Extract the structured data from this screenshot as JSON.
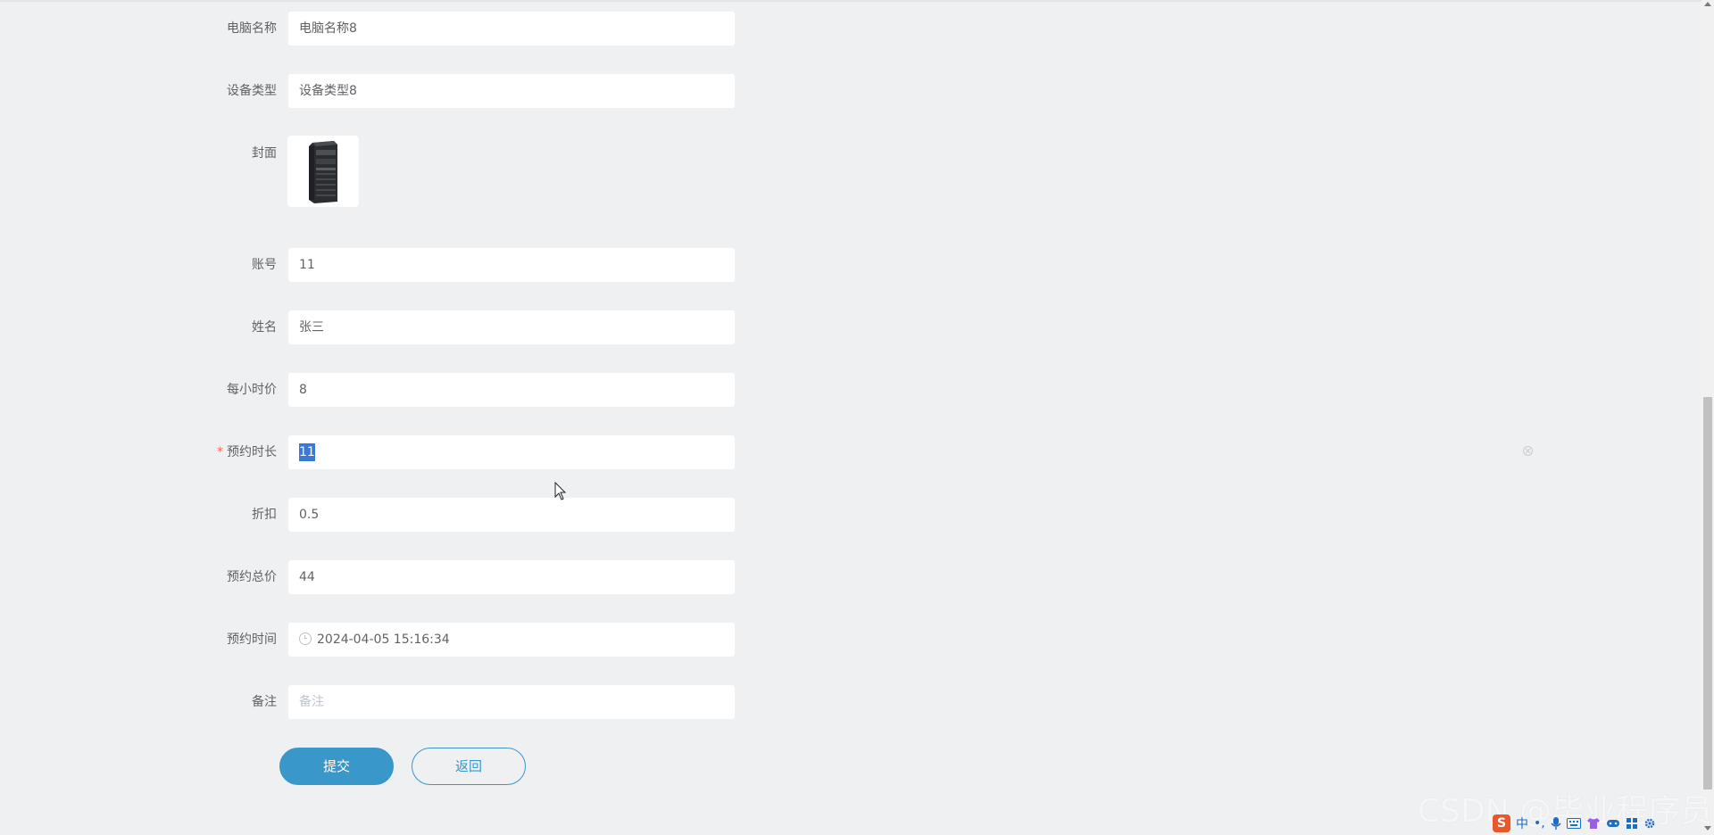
{
  "form": {
    "computer_name": {
      "label": "电脑名称",
      "value": "电脑名称8"
    },
    "device_type": {
      "label": "设备类型",
      "value": "设备类型8"
    },
    "cover": {
      "label": "封面",
      "image": "desktop-tower-pc-icon"
    },
    "account": {
      "label": "账号",
      "value": "11"
    },
    "name": {
      "label": "姓名",
      "value": "张三"
    },
    "hourly_price": {
      "label": "每小时价",
      "value": "8"
    },
    "duration": {
      "label": "预约时长",
      "required_mark": "*",
      "value": "11"
    },
    "discount": {
      "label": "折扣",
      "value": "0.5"
    },
    "total_price": {
      "label": "预约总价",
      "value": "44"
    },
    "booking_time": {
      "label": "预约时间",
      "value": "2024-04-05 15:16:34",
      "icon": "clock-icon"
    },
    "remark": {
      "label": "备注",
      "placeholder": "备注",
      "value": ""
    }
  },
  "buttons": {
    "submit": "提交",
    "back": "返回"
  },
  "watermark": "CSDN @毕业程序员",
  "ime": {
    "logo": "S",
    "mode": "中",
    "punct": "•,",
    "icons": [
      "microphone-icon",
      "keyboard-icon",
      "shirt-icon",
      "game-icon",
      "grid-icon",
      "settings-icon"
    ]
  },
  "colors": {
    "primary": "#3a97c9",
    "background": "#eef0f2",
    "required": "#f56c6c",
    "selection": "#3b78d8"
  }
}
